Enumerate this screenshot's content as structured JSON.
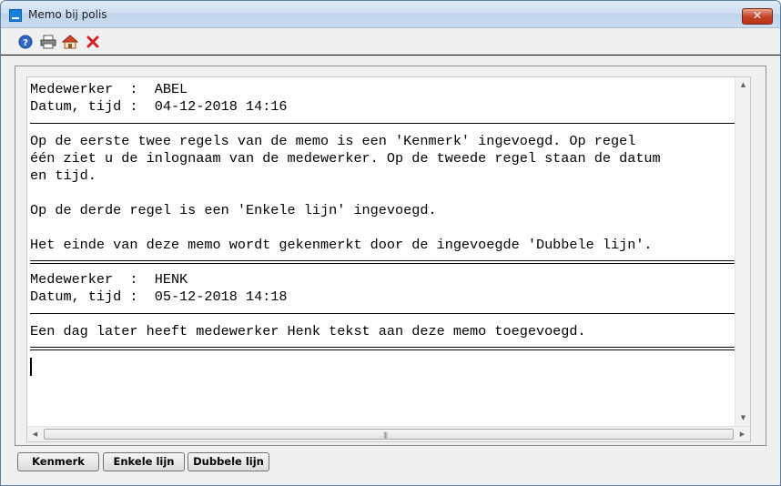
{
  "window": {
    "title": "Memo bij polis",
    "close_label": "✕"
  },
  "toolbar": {
    "icons": [
      "help-icon",
      "print-icon",
      "home-icon",
      "close-icon"
    ]
  },
  "memo": {
    "lines": [
      {
        "type": "text",
        "text": "Medewerker  :  ABEL"
      },
      {
        "type": "text",
        "text": "Datum, tijd :  04-12-2018 14:16"
      },
      {
        "type": "single-rule"
      },
      {
        "type": "text",
        "text": "Op de eerste twee regels van de memo is een 'Kenmerk' ingevoegd. Op regel"
      },
      {
        "type": "text",
        "text": "één ziet u de inlognaam van de medewerker. Op de tweede regel staan de datum"
      },
      {
        "type": "text",
        "text": "en tijd."
      },
      {
        "type": "text",
        "text": ""
      },
      {
        "type": "text",
        "text": "Op de derde regel is een 'Enkele lijn' ingevoegd."
      },
      {
        "type": "text",
        "text": ""
      },
      {
        "type": "text",
        "text": "Het einde van deze memo wordt gekenmerkt door de ingevoegde 'Dubbele lijn'."
      },
      {
        "type": "double-rule"
      },
      {
        "type": "text",
        "text": "Medewerker  :  HENK"
      },
      {
        "type": "text",
        "text": "Datum, tijd :  05-12-2018 14:18"
      },
      {
        "type": "single-rule"
      },
      {
        "type": "text",
        "text": "Een dag later heeft medewerker Henk tekst aan deze memo toegevoegd."
      },
      {
        "type": "double-rule"
      }
    ]
  },
  "buttons": {
    "kenmerk": "Kenmerk",
    "enkele_lijn": "Enkele lijn",
    "dubbele_lijn": "Dubbele lijn"
  },
  "colors": {
    "titlebar": "#cfdff1",
    "close_button": "#c7462b",
    "window_bg": "#f0f0f0"
  }
}
